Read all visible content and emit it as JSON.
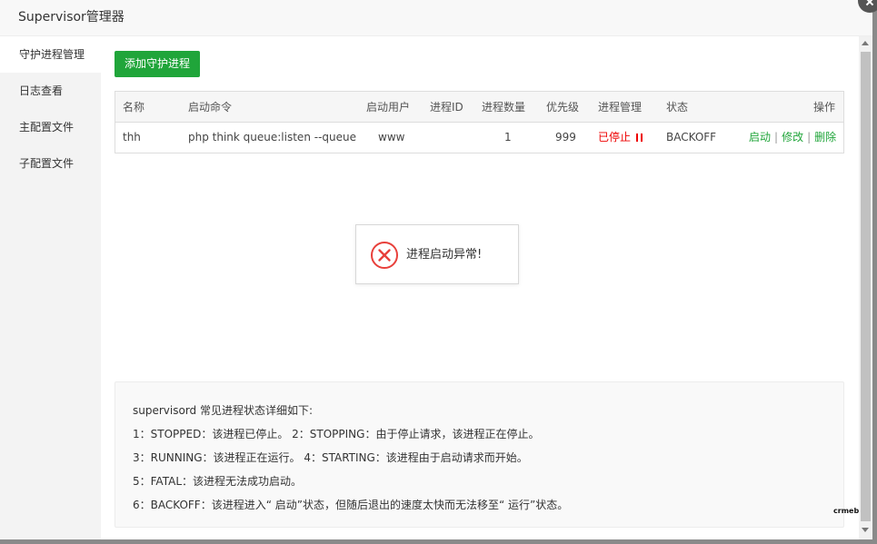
{
  "dialog": {
    "title": "Supervisor管理器"
  },
  "sidebar": {
    "items": [
      {
        "label": "守护进程管理",
        "active": true
      },
      {
        "label": "日志查看"
      },
      {
        "label": "主配置文件"
      },
      {
        "label": "子配置文件"
      }
    ]
  },
  "main": {
    "add_button": "添加守护进程",
    "table": {
      "headers": [
        "名称",
        "启动命令",
        "启动用户",
        "进程ID",
        "进程数量",
        "优先级",
        "进程管理",
        "状态",
        "操作"
      ],
      "rows": [
        {
          "name": "thh",
          "command": "php think queue:listen --queue",
          "user": "www",
          "pid": "",
          "count": "1",
          "priority": "999",
          "manage": "已停止",
          "status": "BACKOFF",
          "ops": {
            "start": "启动",
            "edit": "修改",
            "delete": "删除",
            "separator": "|"
          }
        }
      ]
    },
    "toast": {
      "message": "进程启动异常!",
      "icon": "error-circle-icon",
      "color": "#e8403b"
    },
    "info": {
      "lines": [
        "supervisord 常见进程状态详细如下:",
        "1：STOPPED：该进程已停止。     2：STOPPING：由于停止请求，该进程正在停止。",
        "3：RUNNING：该进程正在运行。 4：STARTING：该进程由于启动请求而开始。",
        "5：FATAL：该进程无法成功启动。",
        "6：BACKOFF：该进程进入“ 启动”状态，但随后退出的速度太快而无法移至“ 运行”状态。"
      ]
    }
  },
  "watermark": "crmeb",
  "colors": {
    "accent": "#20a53a",
    "danger": "#e00000"
  }
}
